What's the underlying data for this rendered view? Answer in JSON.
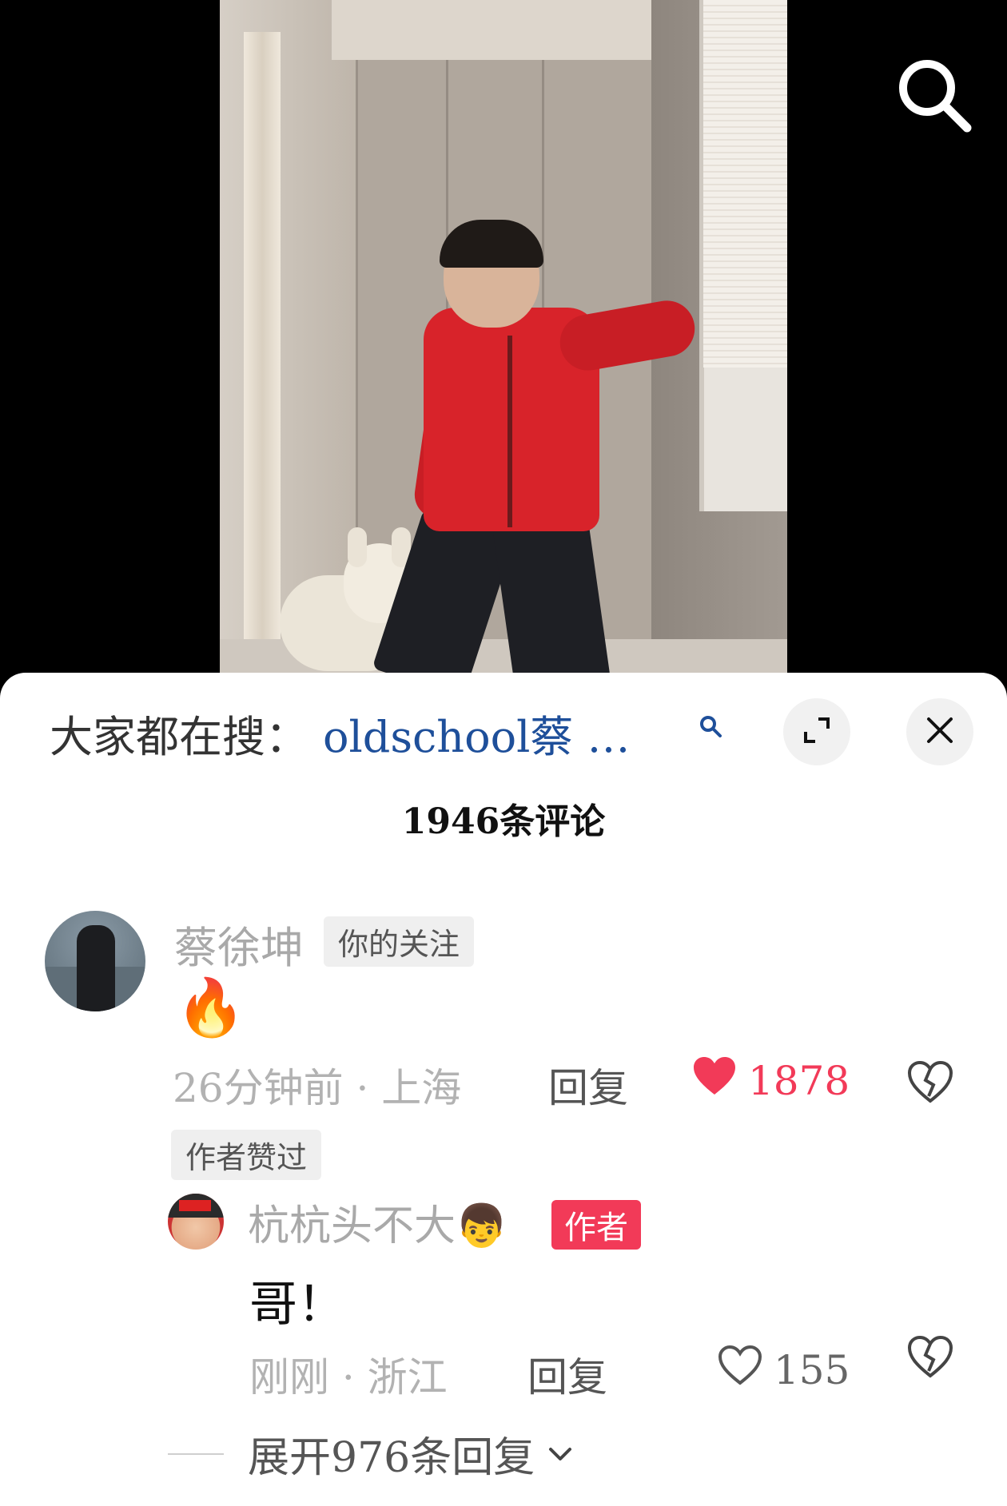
{
  "hot_search": {
    "prefix": "大家都在搜：",
    "query": "oldschool蔡 …"
  },
  "comments_count_label": "1946条评论",
  "comment": {
    "username": "蔡徐坤",
    "follow_badge": "你的关注",
    "content": "🔥",
    "meta": "26分钟前 · 上海",
    "reply_label": "回复",
    "likes": "1878",
    "author_liked_badge": "作者赞过"
  },
  "reply": {
    "username": "杭杭头不大👦",
    "author_badge": "作者",
    "content": "哥！",
    "meta": "刚刚 · 浙江",
    "reply_label": "回复",
    "likes": "155"
  },
  "expand_replies_label": "展开976条回复",
  "colors": {
    "accent_red": "#f23a58",
    "hot_search_blue": "#1e4f9a",
    "meta_gray": "#b2b2b2"
  },
  "icons": [
    "search-icon",
    "expand-icon",
    "close-icon",
    "heart-filled-icon",
    "heart-outline-icon",
    "dislike-icon",
    "chevron-down-icon"
  ]
}
